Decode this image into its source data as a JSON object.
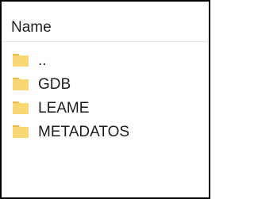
{
  "header": {
    "column_label": "Name"
  },
  "colors": {
    "folder_fill": "#F8D775",
    "folder_tab": "#E8B94A",
    "text": "#1F1F1F",
    "border": "#000000"
  },
  "items": [
    {
      "label": "..",
      "icon": "folder-icon"
    },
    {
      "label": "GDB",
      "icon": "folder-icon"
    },
    {
      "label": "LEAME",
      "icon": "folder-icon"
    },
    {
      "label": "METADATOS",
      "icon": "folder-icon"
    }
  ]
}
